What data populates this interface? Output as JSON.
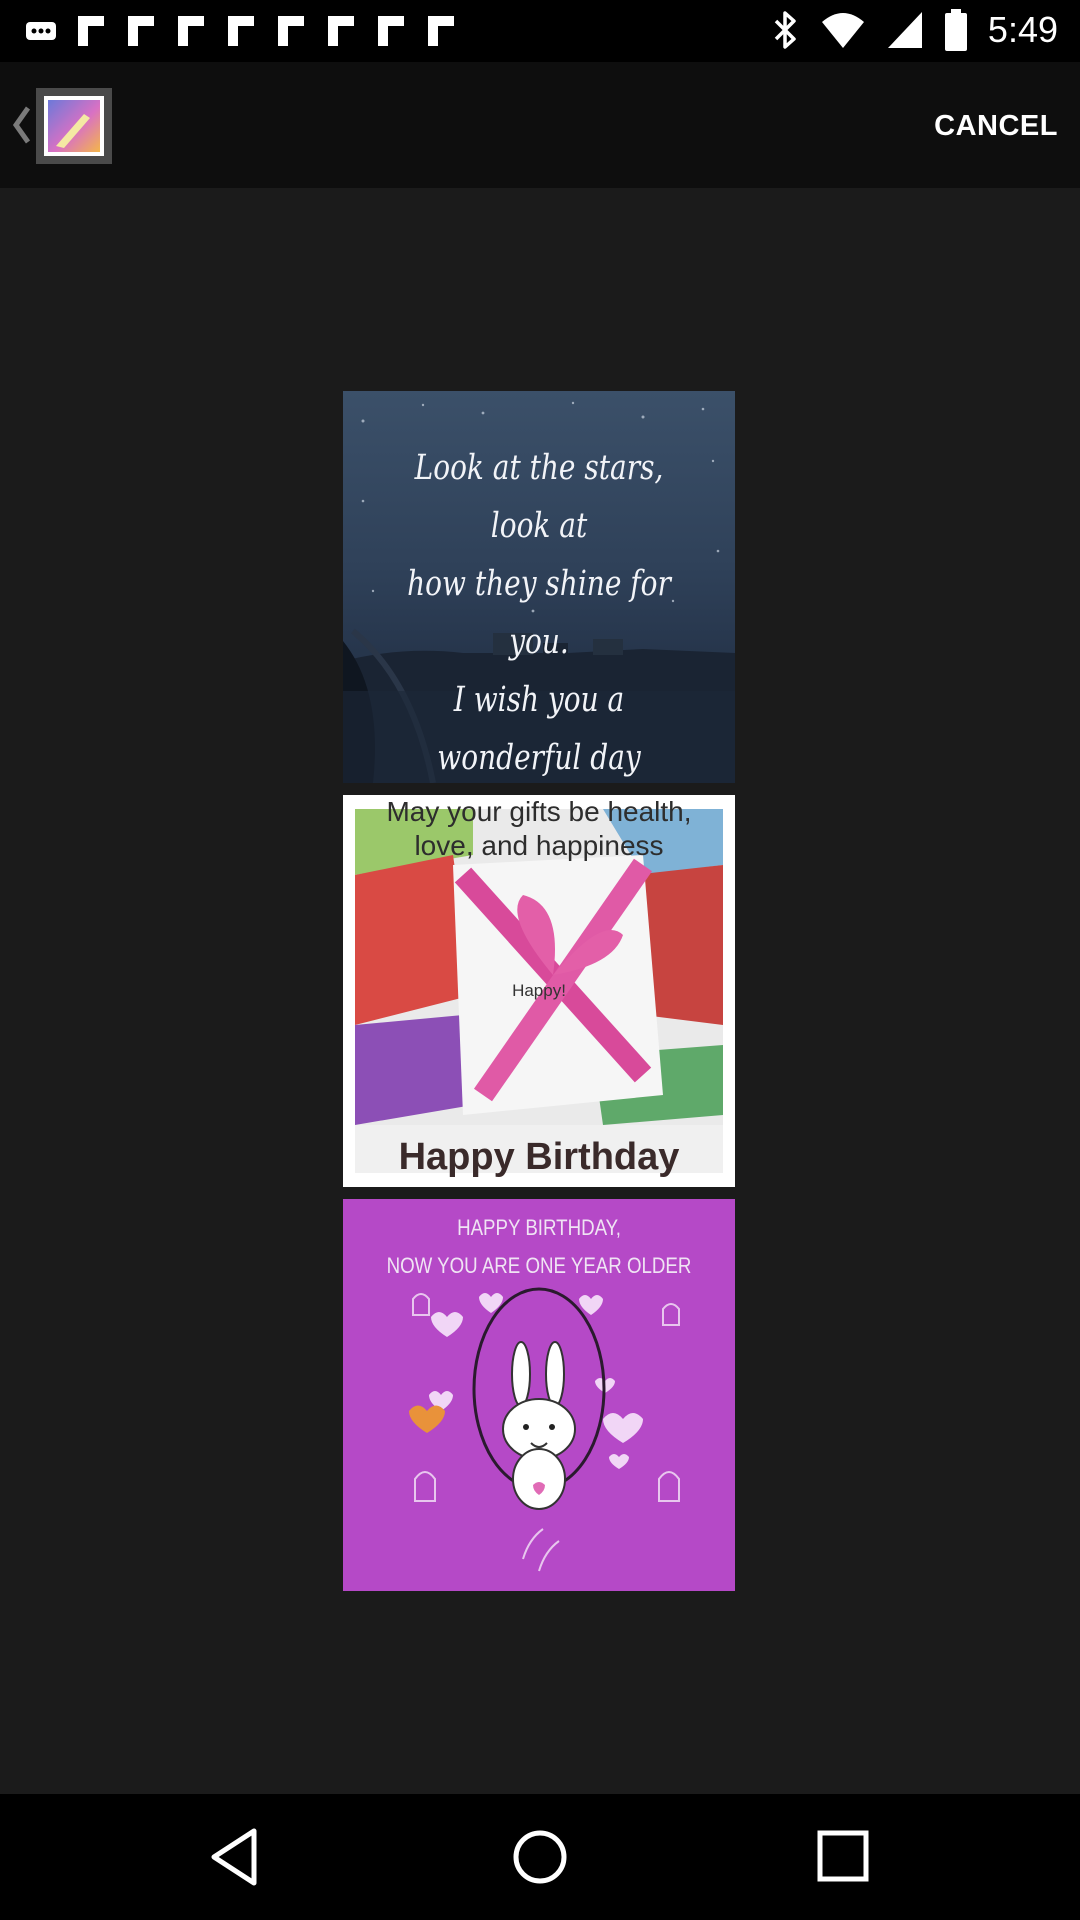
{
  "status_bar": {
    "time": "5:49",
    "notification_icons": [
      "more-icon",
      "flipboard-icon",
      "flipboard-icon",
      "flipboard-icon",
      "flipboard-icon",
      "flipboard-icon",
      "flipboard-icon",
      "flipboard-icon",
      "flipboard-icon"
    ],
    "right_icons": [
      "bluetooth-icon",
      "wifi-icon",
      "cell-signal-icon",
      "battery-icon"
    ]
  },
  "action_bar": {
    "app_icon": "gallery-icon",
    "cancel_label": "CANCEL"
  },
  "cards": [
    {
      "text": "Look at the stars, look at\nhow they shine for you.\nI wish you a wonderful day"
    },
    {
      "text_top": "May your gifts be health,\nlove, and happiness",
      "text_mid": "Happy!",
      "text_bottom": "Happy Birthday"
    },
    {
      "text_top": "HAPPY BIRTHDAY,\nNOW YOU ARE ONE YEAR OLDER"
    }
  ],
  "nav_bar": {
    "back": "back-icon",
    "home": "home-icon",
    "recents": "recents-icon"
  },
  "colors": {
    "background": "#1b1b1b",
    "action_bar": "#0e0e0e",
    "card3_purple": "#b549c7"
  }
}
